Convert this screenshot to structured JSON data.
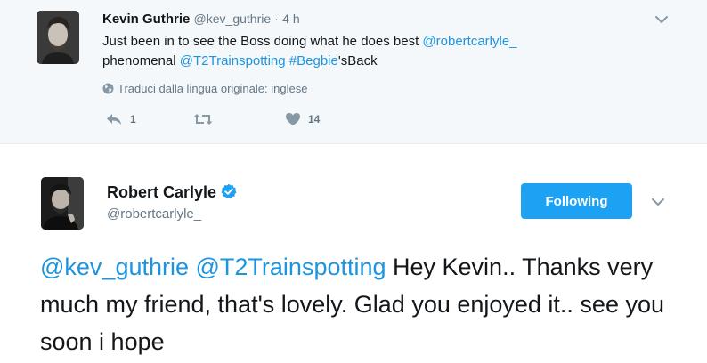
{
  "parent_tweet": {
    "author_name": "Kevin Guthrie",
    "author_handle": "@kev_guthrie",
    "separator": "·",
    "timestamp": "4 h",
    "text": {
      "part1": "Just been in to see the Boss doing what he does best ",
      "mention1": "@robertcarlyle_",
      "part2": "phenomenal ",
      "mention2": "@T2Trainspotting",
      "space": " ",
      "hashtag": "#Begbie",
      "part3": "'sBack"
    },
    "translate_label": "Traduci dalla lingua originale: inglese",
    "actions": {
      "reply_count": "1",
      "retweet_count": "",
      "like_count": "14"
    }
  },
  "main_tweet": {
    "author_name": "Robert Carlyle",
    "author_handle": "@robertcarlyle_",
    "verified": true,
    "follow_button_label": "Following",
    "text": {
      "mention1": "@kev_guthrie",
      "mention2": "@T2Trainspotting",
      "body": " Hey Kevin.. Thanks very much my friend, that's lovely. Glad you enjoyed it.. see you soon i hope"
    }
  },
  "colors": {
    "accent": "#1da1f2",
    "link": "#1b95e0",
    "secondary_text": "#657786",
    "parent_background": "#f5f8fa"
  },
  "icons": {
    "chevron": "chevron-down-icon",
    "globe": "globe-icon",
    "reply": "reply-icon",
    "retweet": "retweet-icon",
    "like": "heart-icon",
    "verified": "verified-badge-icon"
  }
}
